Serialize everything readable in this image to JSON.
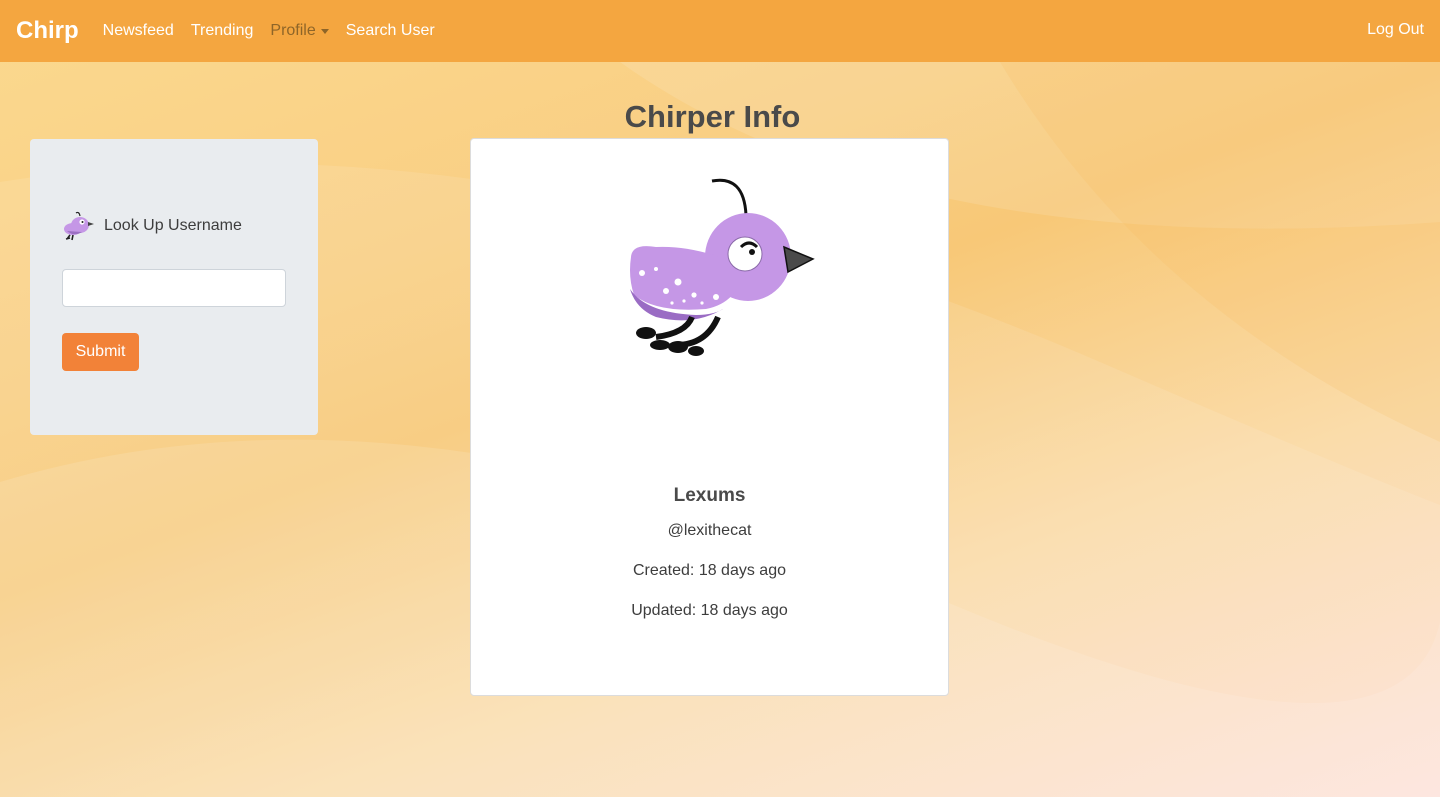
{
  "navbar": {
    "brand": "Chirp",
    "links": [
      "Newsfeed",
      "Trending",
      "Profile",
      "Search User"
    ],
    "logout": "Log Out"
  },
  "page": {
    "title": "Chirper Info"
  },
  "lookup": {
    "label": "Look Up Username",
    "input_value": "",
    "submit_label": "Submit"
  },
  "profile": {
    "display_name": "Lexums",
    "handle": "@lexithecat",
    "created": "Created: 18 days ago",
    "updated": "Updated: 18 days ago"
  },
  "colors": {
    "navbar": "#f4a640",
    "submit_button": "#f28238",
    "bird_body": "#c597e6"
  }
}
